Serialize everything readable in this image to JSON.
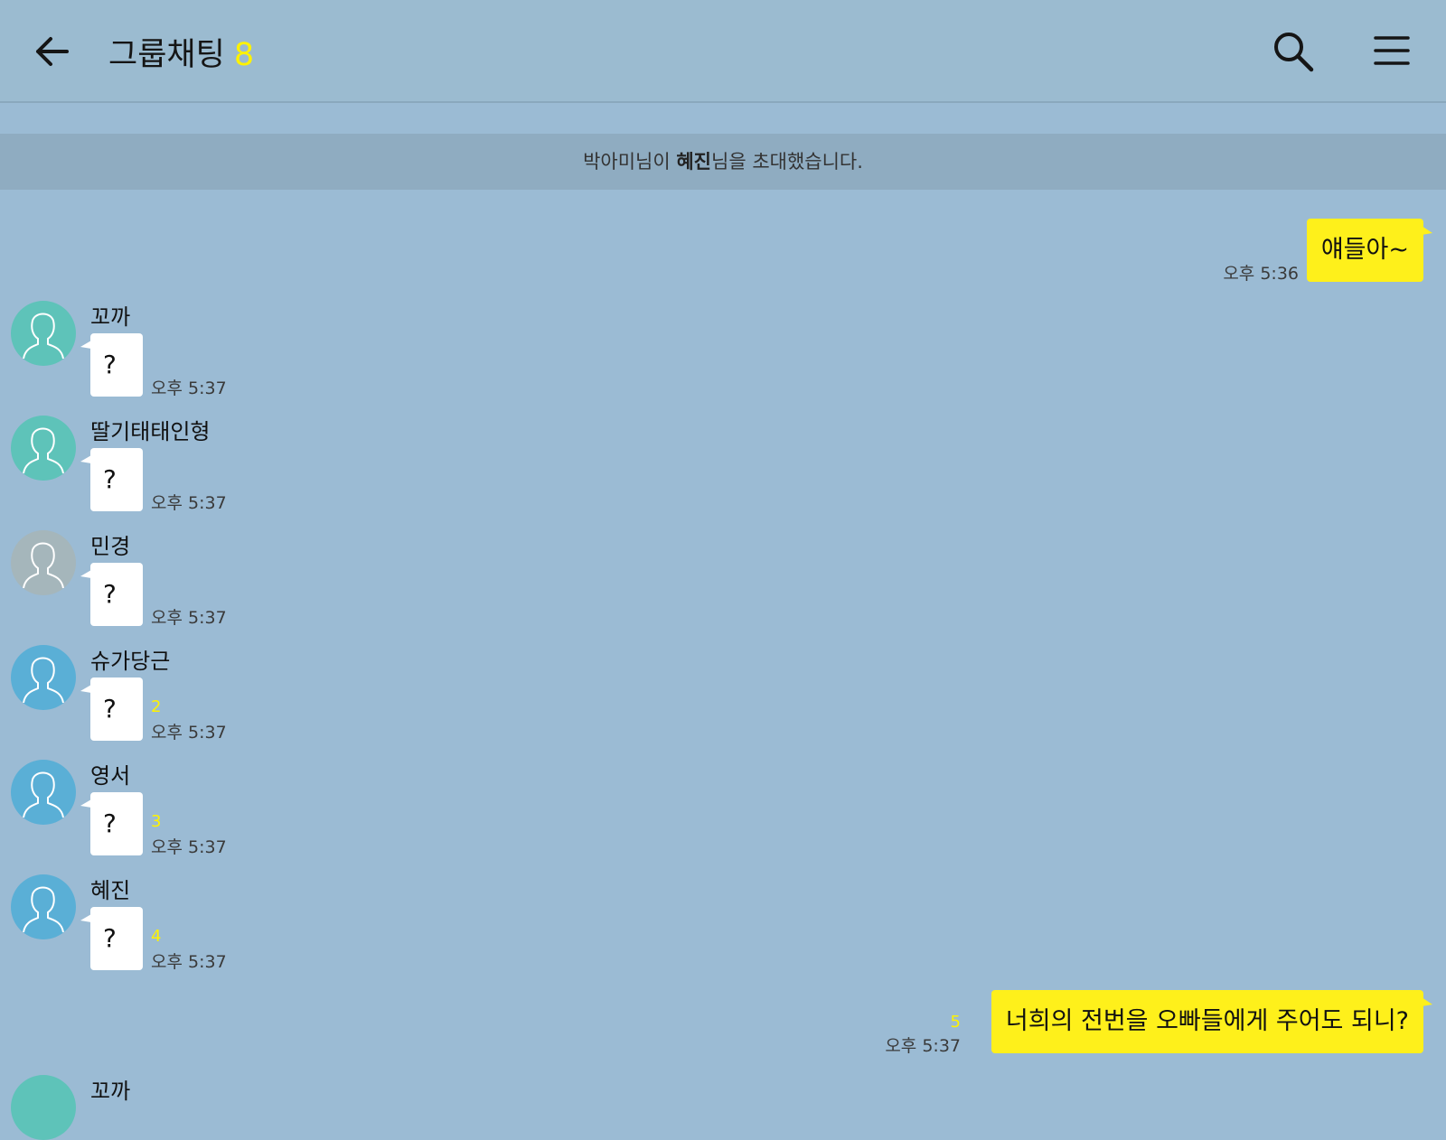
{
  "header": {
    "title": "그룹채팅",
    "member_count": "8"
  },
  "system_notice": {
    "pre": "박아미님이 ",
    "name": "혜진",
    "post": "님을 초대했습니다."
  },
  "outgoing": [
    {
      "text": "얘들아~",
      "time": "오후 5:36",
      "unread": ""
    },
    {
      "text": "너희의 전번을 오빠들에게 주어도 되니?",
      "time": "오후 5:37",
      "unread": "5"
    }
  ],
  "incoming": [
    {
      "sender": "꼬까",
      "text": "?",
      "time": "오후 5:37",
      "unread": ""
    },
    {
      "sender": "딸기태태인형",
      "text": "?",
      "time": "오후 5:37",
      "unread": ""
    },
    {
      "sender": "민경",
      "text": "?",
      "time": "오후 5:37",
      "unread": ""
    },
    {
      "sender": "슈가당근",
      "text": "?",
      "time": "오후 5:37",
      "unread": "2"
    },
    {
      "sender": "영서",
      "text": "?",
      "time": "오후 5:37",
      "unread": "3"
    },
    {
      "sender": "혜진",
      "text": "?",
      "time": "오후 5:37",
      "unread": "4"
    }
  ],
  "partial": {
    "sender": "꼬까"
  },
  "colors": {
    "background": "#9bbbd4",
    "my_bubble": "#fef01b",
    "unread": "#fff200"
  }
}
